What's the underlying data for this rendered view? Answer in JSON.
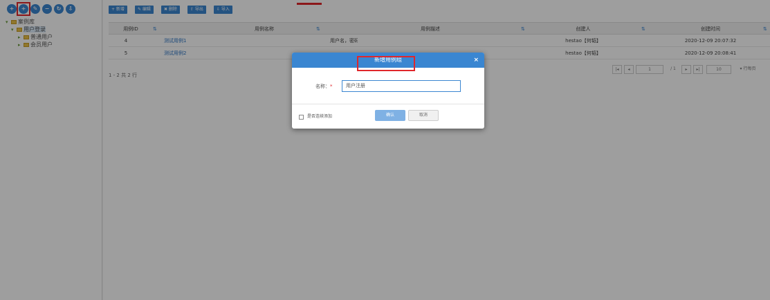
{
  "tree_toolbar": {
    "icons": [
      "circle-icon-1",
      "circle-icon-2",
      "circle-icon-3",
      "circle-icon-4",
      "circle-icon-5",
      "circle-icon-6"
    ]
  },
  "tree": {
    "root": "案例库",
    "group": "用户登录",
    "children": [
      "普通用户",
      "会员用户"
    ]
  },
  "toolbar": {
    "buttons": [
      "+ 新增",
      "✎ 编辑",
      "✖ 删除",
      "⇧ 导出",
      "⇩ 导入"
    ]
  },
  "grid": {
    "columns": [
      "用例ID",
      "用例名称",
      "用例描述",
      "创建人",
      "创建时间"
    ],
    "rows": [
      {
        "id": "4",
        "name": "测试用例1",
        "desc": "用户名，密码",
        "creator": "hestao【何韬】",
        "time": "2020-12-09 20:07:32"
      },
      {
        "id": "5",
        "name": "测试用例2",
        "desc": "",
        "creator": "hestao【何韬】",
        "time": "2020-12-09 20:08:41"
      }
    ]
  },
  "pager": {
    "summary": "1 - 2 共 2 行",
    "first": "|◂",
    "prev": "◂",
    "page": "1",
    "of": "/ 1",
    "next": "▸",
    "last": "▸|",
    "size": "10",
    "size_suffix": "▾ 行每页"
  },
  "dialog": {
    "title": "新增用例组",
    "close": "×",
    "field_label": "名称：",
    "required_mark": "*",
    "field_value": "用户注册",
    "checkbox_label": "是否连续添加",
    "confirm": "确认",
    "cancel": "取消"
  },
  "colors": {
    "primary": "#3a86d1",
    "highlight": "#e0262b",
    "overlay": "rgba(0,0,0,0.38)"
  }
}
